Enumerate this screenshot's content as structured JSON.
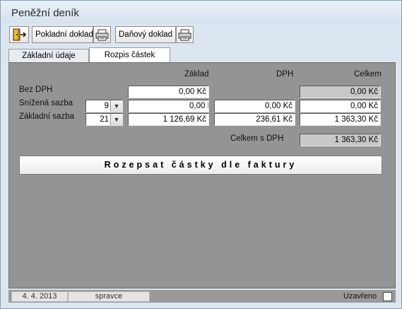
{
  "window": {
    "title": "Peněžní deník"
  },
  "toolbar": {
    "cash_doc_label": "Pokladní doklad",
    "tax_doc_label": "Daňový doklad"
  },
  "tabs": [
    {
      "label": "Základní údaje",
      "active": false
    },
    {
      "label": "Rozpis částek",
      "active": true
    }
  ],
  "table": {
    "headers": {
      "zaklad": "Základ",
      "dph": "DPH",
      "celkem": "Celkem"
    },
    "rows": {
      "bez_dph": {
        "label": "Bez  DPH",
        "zaklad": "0,00 Kč",
        "celkem": "0,00 Kč"
      },
      "snizena": {
        "label": "Snížená sazba",
        "rate": "9",
        "zaklad": "0,00 Kč",
        "dph": "0,00 Kč",
        "celkem": "0,00 Kč"
      },
      "zakladni": {
        "label": "Základní sazba",
        "rate": "21",
        "zaklad": "1 126,69 Kč",
        "dph": "236,61 Kč",
        "celkem": "1 363,30 Kč"
      }
    },
    "total": {
      "label": "Celkem s DPH",
      "value": "1 363,30 Kč"
    }
  },
  "action": {
    "label": "Rozepsat částky dle faktury"
  },
  "status": {
    "date": "4. 4. 2013",
    "user": "spravce",
    "closed_label": "Uzavřeno",
    "closed": false
  },
  "colors": {
    "panel": "#949494",
    "window": "#dce6f0",
    "readonly_field": "#c8c8c8"
  },
  "icons": {
    "exit": "exit-door-icon",
    "print": "printer-icon",
    "dropdown": "chevron-down-icon"
  }
}
